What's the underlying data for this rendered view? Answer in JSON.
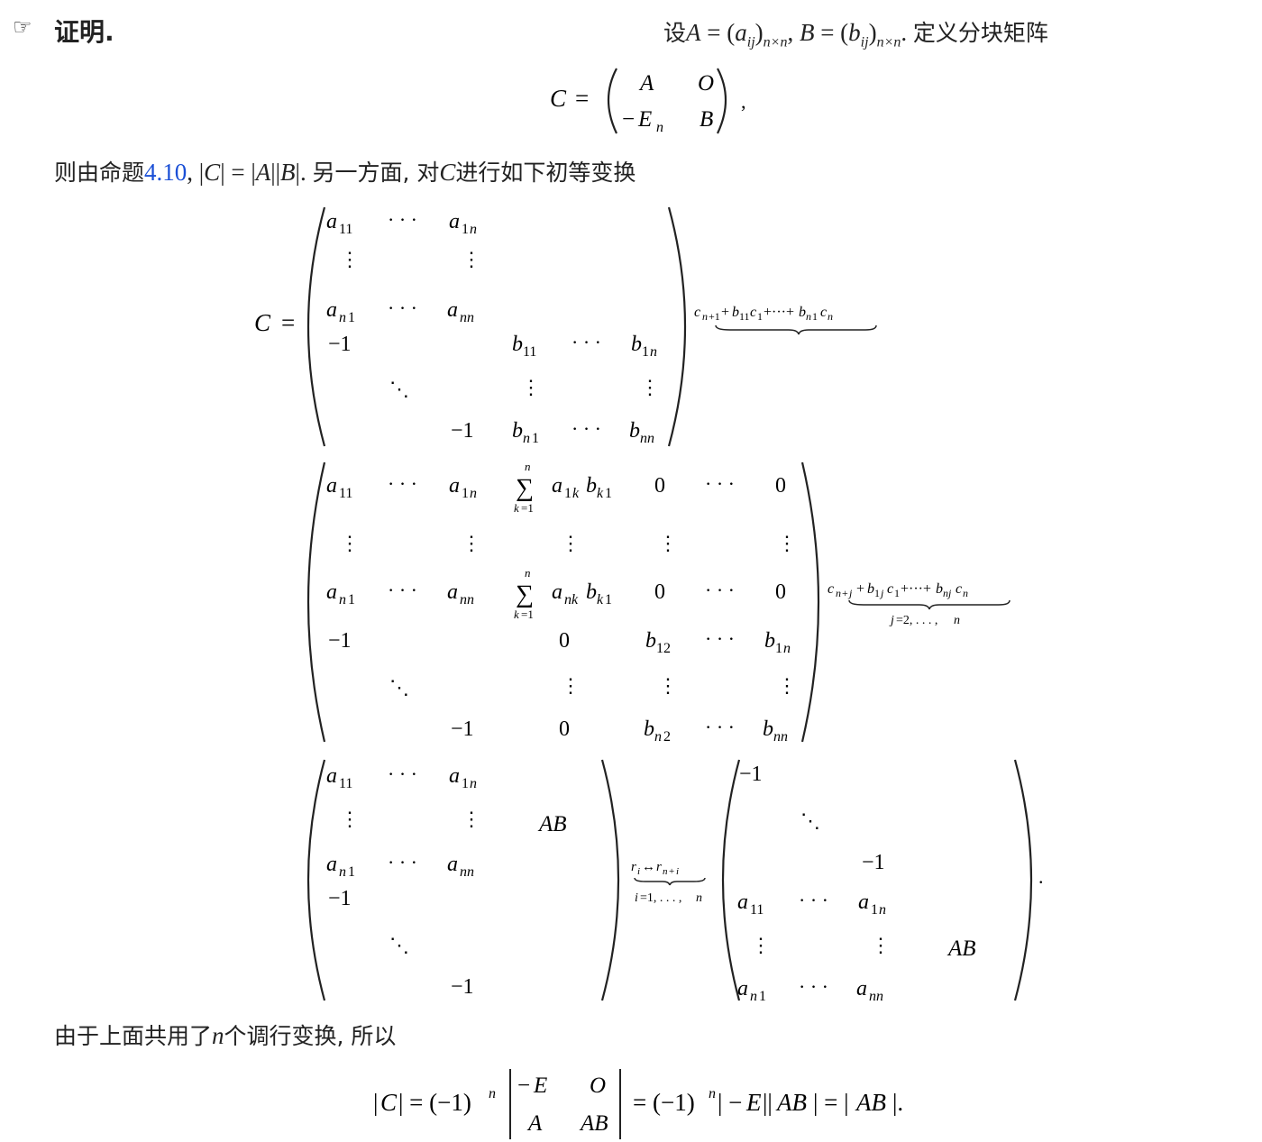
{
  "header": {
    "icon": "pointing-hand-icon",
    "title": "证明."
  },
  "intro": {
    "text_setup": "设A = (a",
    "def_A": "设A = (aij)n×n, B = (bij)n×n.",
    "def_suffix": "定义分块矩阵"
  },
  "block_matrix": {
    "lhs": "C =",
    "entries": [
      "A",
      "O",
      "−E",
      "B"
    ],
    "trailing": ","
  },
  "line2": {
    "prefix": "则由命题",
    "ref": "4.10",
    "middle": ", |C| = |A||B|. 另一方面, 对",
    "C": "C",
    "suffix": "进行如下初等变换"
  },
  "op1": "c_{n+1}+b_{11}c_1+···+b_{n1}c_n",
  "op2_top": "c_{n+j}+b_{1j}c_1+···+b_{nj}c_n",
  "op2_bottom": "j=2,...,n",
  "op3_top": "r_i↔r_{n+i}",
  "op3_bottom": "i=1,...,n",
  "line3": {
    "prefix": "由于上面共用了",
    "n": "n",
    "suffix": "个调行变换, 所以"
  },
  "final": "|C| = (−1)^n |−E O; A AB| = (−1)^n|−E||AB| = |AB|."
}
